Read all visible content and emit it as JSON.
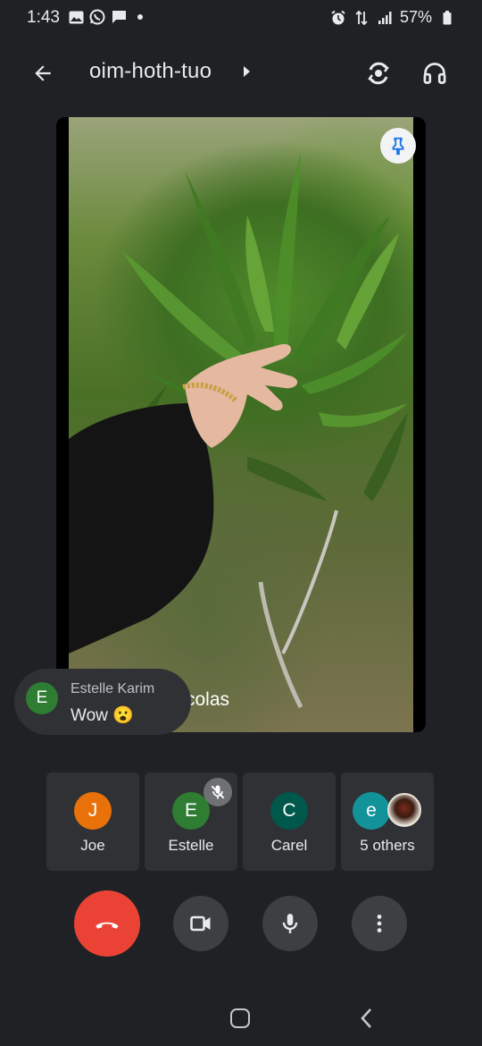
{
  "status_bar": {
    "time": "1:43",
    "battery": "57%",
    "left_icons": [
      "gallery-icon",
      "whatsapp-icon",
      "chat-notification-icon",
      "dot-icon"
    ],
    "right_icons": [
      "alarm-icon",
      "data-arrows-icon",
      "signal-icon",
      "battery-icon"
    ]
  },
  "app_bar": {
    "title": "oim-hoth-tuo",
    "icons": [
      "back-arrow-icon",
      "caret-right-icon",
      "switch-camera-icon",
      "headphones-icon"
    ]
  },
  "main_video": {
    "name_label_partial": "colas",
    "pin_icon": "pin-icon"
  },
  "chat_toast": {
    "avatar_letter": "E",
    "sender": "Estelle Karim",
    "message": "Wow 😮"
  },
  "participants": [
    {
      "initial": "J",
      "name": "Joe",
      "color": "#e8710a",
      "muted": false
    },
    {
      "initial": "E",
      "name": "Estelle",
      "color": "#2e7d32",
      "muted": true
    },
    {
      "initial": "C",
      "name": "Carel",
      "color": "#00574b",
      "muted": false
    },
    {
      "initial": "e",
      "name": "5 others",
      "color": "#12939a",
      "muted": false
    }
  ],
  "controls": [
    "end-call-icon",
    "camera-icon",
    "microphone-icon",
    "more-options-icon"
  ],
  "colors": {
    "background": "#202124",
    "end_call": "#ea4335",
    "control_bg": "#3c4043",
    "tile_bg": "#303134"
  }
}
